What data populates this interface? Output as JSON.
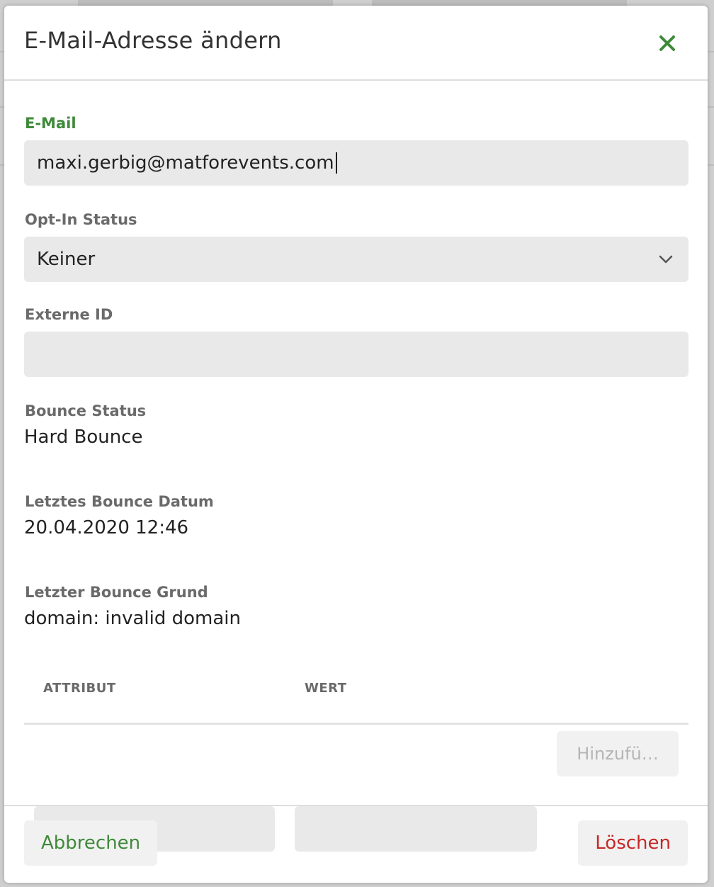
{
  "modal": {
    "title": "E-Mail-Adresse ändern"
  },
  "form": {
    "email_label": "E-Mail",
    "email_value": "maxi.gerbig@matforevents.com",
    "optin_label": "Opt-In Status",
    "optin_value": "Keiner",
    "external_id_label": "Externe ID",
    "external_id_value": "",
    "bounce_status_label": "Bounce Status",
    "bounce_status_value": "Hard Bounce",
    "last_bounce_date_label": "Letztes Bounce Datum",
    "last_bounce_date_value": "20.04.2020 12:46",
    "last_bounce_reason_label": "Letzter Bounce Grund",
    "last_bounce_reason_value": "domain: invalid domain"
  },
  "attributes": {
    "col_attribute": "ATTRIBUT",
    "col_value": "WERT",
    "add_label": "Hinzufü…"
  },
  "footer": {
    "cancel_label": "Abbrechen",
    "delete_label": "Löschen"
  },
  "colors": {
    "accent_green": "#3f8a3a",
    "danger_red": "#c62828"
  },
  "icons": {
    "close": "close-icon",
    "dropdown": "chevron-down-icon"
  }
}
